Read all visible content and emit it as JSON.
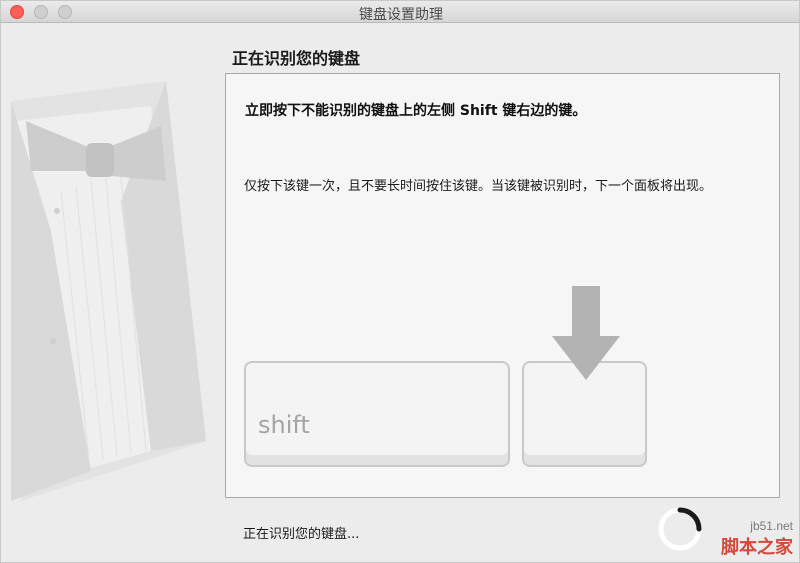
{
  "window": {
    "title": "键盘设置助理"
  },
  "page": {
    "heading": "正在识别您的键盘",
    "instruction": "立即按下不能识别的键盘上的左侧 Shift 键右边的键。",
    "note": "仅按下该键一次，且不要长时间按住该键。当该键被识别时，下一个面板将出现。",
    "shift_key_label": "shift",
    "status": "正在识别您的键盘..."
  },
  "watermark": {
    "url": "jb51.net",
    "name": "脚本之家"
  },
  "icons": {
    "close": "close-button",
    "minimize": "minimize-button",
    "maximize": "zoom-button",
    "arrow": "down-arrow-icon",
    "illustration": "tuxedo-illustration"
  },
  "colors": {
    "close": "#fc5f57",
    "panel_bg": "#f6f6f6",
    "window_bg": "#ececec",
    "watermark_red": "#d24a3c"
  }
}
